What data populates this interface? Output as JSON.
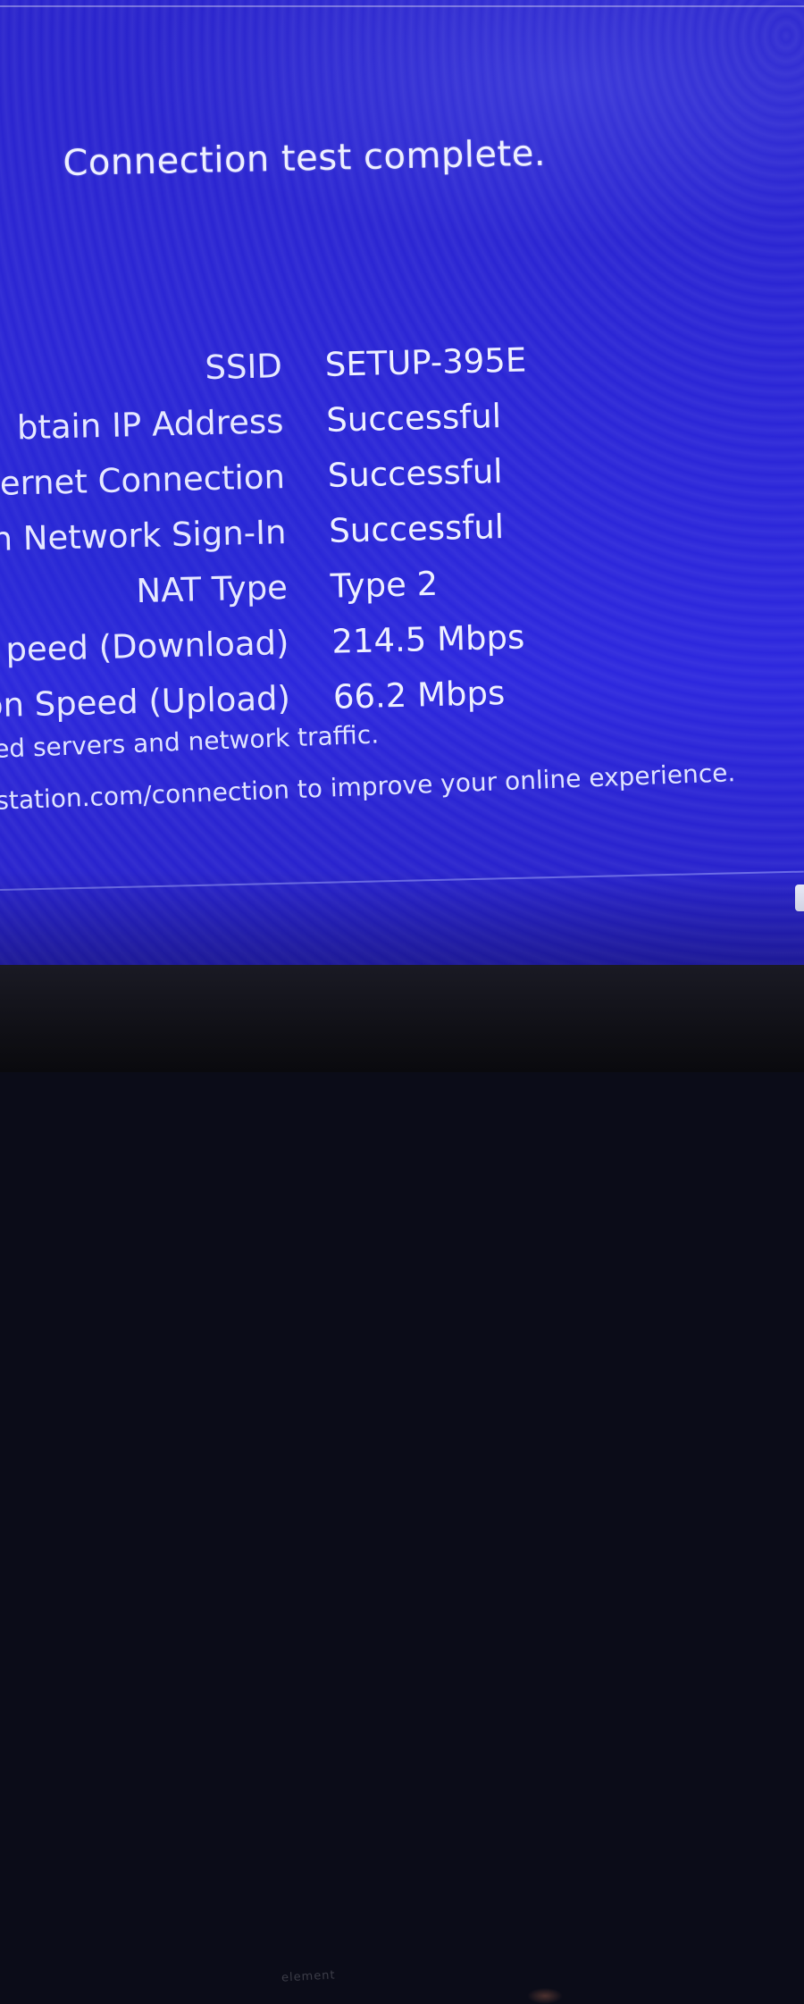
{
  "screen": {
    "title": "Connection test complete.",
    "results": [
      {
        "label": "SSID",
        "value": "SETUP-395E"
      },
      {
        "label": "btain IP Address",
        "value": "Successful"
      },
      {
        "label": "ernet Connection",
        "value": "Successful"
      },
      {
        "label": "n Network Sign-In",
        "value": "Successful"
      },
      {
        "label": "NAT Type",
        "value": "Type 2"
      },
      {
        "label": "peed (Download)",
        "value": "214.5 Mbps"
      },
      {
        "label": "on Speed (Upload)",
        "value": "66.2 Mbps"
      }
    ],
    "notes": [
      "ed servers and network traffic.",
      "station.com/connection to improve your online experience."
    ]
  },
  "monitor": {
    "brand": "element"
  },
  "colors": {
    "background": "#2b26d6",
    "text": "#eef0ff",
    "bezel": "#101016"
  }
}
